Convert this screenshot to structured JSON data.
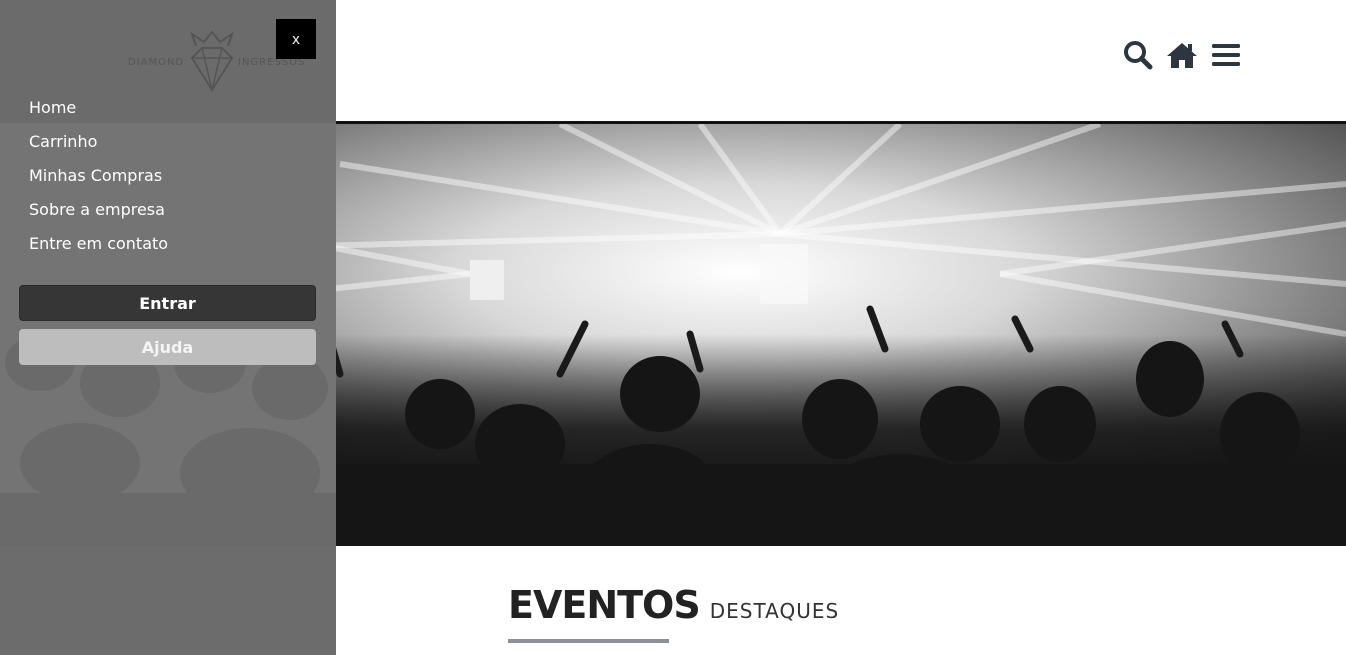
{
  "sidebar": {
    "logo": {
      "left_text": "DIAMOND",
      "right_text": "INGRESSOS"
    },
    "close_label": "x",
    "nav": [
      {
        "label": "Home"
      },
      {
        "label": "Carrinho"
      },
      {
        "label": "Minhas Compras"
      },
      {
        "label": "Sobre a empresa"
      },
      {
        "label": "Entre em contato"
      }
    ],
    "enter_label": "Entrar",
    "help_label": "Ajuda"
  },
  "header": {
    "icons": [
      "search-icon",
      "home-icon",
      "menu-icon"
    ],
    "icon_color": "#2c3540"
  },
  "hero": {
    "image": "concert-crowd-bw"
  },
  "section": {
    "title": "EVENTOS",
    "subtitle": "DESTAQUES"
  }
}
